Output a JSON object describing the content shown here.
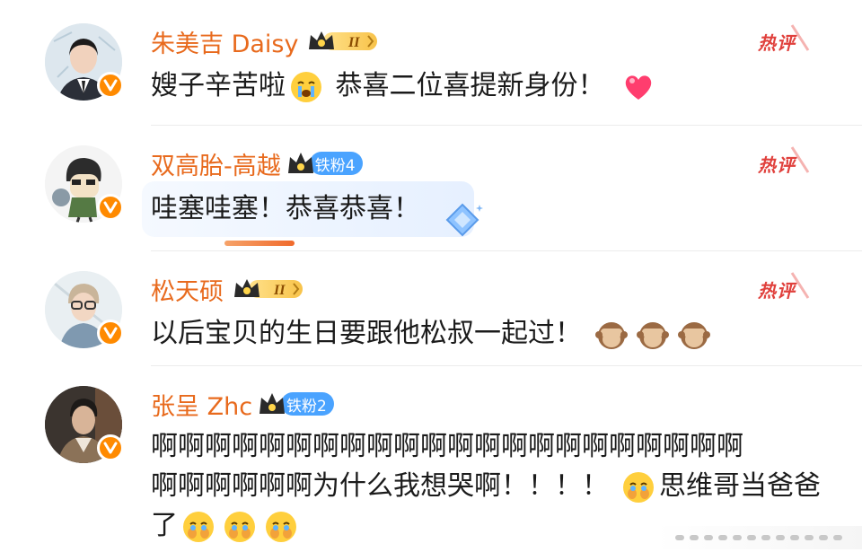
{
  "comments": [
    {
      "username": "朱美吉 Daisy",
      "vip_level": "II",
      "hot_label": "热评",
      "text_before": "嫂子辛苦啦",
      "text_after": " 恭喜二位喜提新身份！",
      "emojis": [
        "crying-face-emoji",
        "heart-emoji"
      ]
    },
    {
      "username": "双高胎-高越",
      "fan_label": "铁粉4",
      "hot_label": "热评",
      "text": "哇塞哇塞！恭喜恭喜！"
    },
    {
      "username": "松天硕",
      "vip_level": "II",
      "hot_label": "热评",
      "text": "以后宝贝的生日要跟他松叔一起过！",
      "emojis": [
        "see-no-evil-monkey-emoji",
        "see-no-evil-monkey-emoji",
        "see-no-evil-monkey-emoji"
      ]
    },
    {
      "username": "张呈 Zhc",
      "fan_label": "铁粉2",
      "line1": "啊啊啊啊啊啊啊啊啊啊啊啊啊啊啊啊啊啊啊啊啊啊",
      "line2_before": "啊啊啊啊啊啊为什么我想哭啊！！！！",
      "line2_after": "思维哥当爸爸",
      "line3": "了",
      "emojis": [
        "teary-face-emoji"
      ]
    }
  ],
  "colors": {
    "username": "#e86a1d",
    "hot_tag": "#e0403c",
    "verify_badge": "#ff8a00",
    "fan_badge": "#4aa3ff"
  }
}
